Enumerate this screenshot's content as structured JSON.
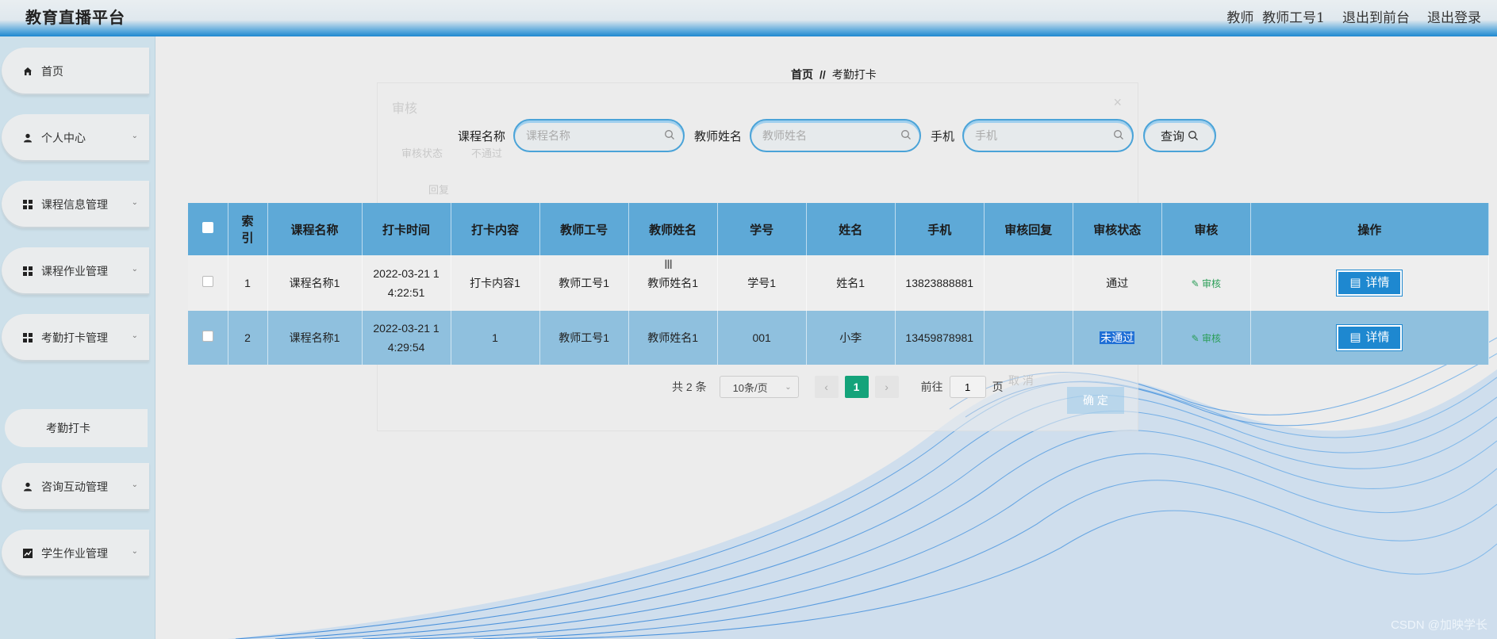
{
  "header": {
    "title": "教育直播平台",
    "role": "教师",
    "user": "教师工号1",
    "to_front": "退出到前台",
    "logout": "退出登录"
  },
  "sidebar": {
    "items": [
      {
        "label": "首页",
        "icon": "home-icon"
      },
      {
        "label": "个人中心",
        "icon": "user-icon"
      },
      {
        "label": "课程信息管理",
        "icon": "grid-icon"
      },
      {
        "label": "课程作业管理",
        "icon": "grid-icon"
      },
      {
        "label": "考勤打卡管理",
        "icon": "grid-icon"
      },
      {
        "label": "咨询互动管理",
        "icon": "user-icon"
      },
      {
        "label": "学生作业管理",
        "icon": "chart-icon"
      }
    ],
    "sub_item": "考勤打卡"
  },
  "breadcrumb": {
    "home": "首页",
    "sep": "//",
    "current": "考勤打卡"
  },
  "search": {
    "course_label": "课程名称",
    "course_placeholder": "课程名称",
    "teacher_label": "教师姓名",
    "teacher_placeholder": "教师姓名",
    "phone_label": "手机",
    "phone_placeholder": "手机",
    "query_label": "查询"
  },
  "ghost_dialog": {
    "title": "审核",
    "close": "×",
    "field_a": "审核状态",
    "field_b": "不通过",
    "field_c": "回复",
    "cancel": "取 消",
    "confirm": "确 定"
  },
  "table": {
    "headers": [
      "索引",
      "课程名称",
      "打卡时间",
      "打卡内容",
      "教师工号",
      "教师姓名",
      "学号",
      "姓名",
      "手机",
      "审核回复",
      "审核状态",
      "审核",
      "操作"
    ],
    "rows": [
      {
        "index": "1",
        "course": "课程名称1",
        "time1": "2022-03-21 1",
        "time2": "4:22:51",
        "content": "打卡内容1",
        "teacher_no": "教师工号1",
        "teacher_name": "教师姓名1",
        "student_no": "学号1",
        "name": "姓名1",
        "phone": "13823888881",
        "reply": "",
        "status": "通过",
        "audit": "审核",
        "detail": "详情"
      },
      {
        "index": "2",
        "course": "课程名称1",
        "time1": "2022-03-21 1",
        "time2": "4:29:54",
        "content": "1",
        "teacher_no": "教师工号1",
        "teacher_name": "教师姓名1",
        "student_no": "001",
        "name": "小李",
        "phone": "13459878981",
        "reply": "",
        "status": "未通过",
        "audit": "审核",
        "detail": "详情"
      }
    ]
  },
  "pagination": {
    "total": "共 2 条",
    "page_size": "10条/页",
    "current": "1",
    "goto_label": "前往",
    "goto_value": "1",
    "page_unit": "页"
  },
  "watermark": "CSDN @加映学长",
  "colors": {
    "accent": "#1e88d0",
    "header_row": "#5ea9d7",
    "selected_row": "#8fc0de",
    "page_active": "#14a37a"
  }
}
